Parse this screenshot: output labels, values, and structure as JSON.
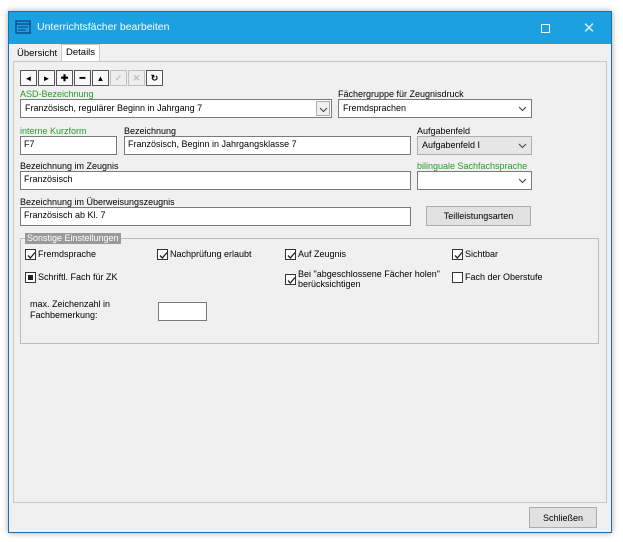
{
  "window": {
    "title": "Unterrichtsfächer bearbeiten"
  },
  "tabs": [
    {
      "label": "Übersicht",
      "active": false
    },
    {
      "label": "Details",
      "active": true
    }
  ],
  "toolbar": [
    {
      "icon": "arrow-left-icon",
      "glyph": "◄",
      "enabled": true
    },
    {
      "icon": "arrow-right-icon",
      "glyph": "►",
      "enabled": true
    },
    {
      "icon": "plus-icon",
      "glyph": "✚",
      "enabled": true
    },
    {
      "icon": "minus-icon",
      "glyph": "━",
      "enabled": true
    },
    {
      "icon": "arrow-up-icon",
      "glyph": "▲",
      "enabled": true
    },
    {
      "icon": "check-icon",
      "glyph": "✓",
      "enabled": false
    },
    {
      "icon": "cancel-icon",
      "glyph": "✕",
      "enabled": false
    },
    {
      "icon": "refresh-icon",
      "glyph": "↻",
      "enabled": true
    }
  ],
  "form": {
    "asd_label": "ASD-Bezeichnung",
    "asd_value": "Französisch, regulärer Beginn in Jahrgang 7",
    "faechergruppe_label": "Fächergruppe für Zeugnisdruck",
    "faechergruppe_value": "Fremdsprachen",
    "kurzform_label": "interne Kurzform",
    "kurzform_value": "F7",
    "bezeichnung_label": "Bezeichnung",
    "bezeichnung_value": "Französisch, Beginn in Jahrgangsklasse 7",
    "aufgabenfeld_label": "Aufgabenfeld",
    "aufgabenfeld_value": "Aufgabenfeld I",
    "zeugnis_label": "Bezeichnung im Zeugnis",
    "zeugnis_value": "Französisch",
    "bilingual_label": "bilinguale Sachfachsprache",
    "bilingual_value": "",
    "ueberweisung_label": "Bezeichnung im Überweisungszeugnis",
    "ueberweisung_value": "Französisch ab Kl. 7",
    "teilleistung_button": "Teilleistungsarten"
  },
  "settings": {
    "title": "Sonstige Einstellungen",
    "fremdsprache": {
      "label": "Fremdsprache",
      "checked": true
    },
    "nachpruefung": {
      "label": "Nachprüfung erlaubt",
      "checked": true
    },
    "auf_zeugnis": {
      "label": "Auf Zeugnis",
      "checked": true
    },
    "sichtbar": {
      "label": "Sichtbar",
      "checked": true
    },
    "schriftl": {
      "label": "Schriftl. Fach für ZK",
      "state": "indeterminate"
    },
    "abgeschlossen": {
      "label_line1": "Bei \"abgeschlossene Fächer holen\"",
      "label_line2": "berücksichtigen",
      "checked": true
    },
    "oberstufe": {
      "label": "Fach der Oberstufe",
      "checked": false
    },
    "max_label_line1": "max. Zeichenzahl in",
    "max_label_line2": "Fachbemerkung:",
    "max_value": ""
  },
  "footer": {
    "close_button": "Schließen"
  }
}
